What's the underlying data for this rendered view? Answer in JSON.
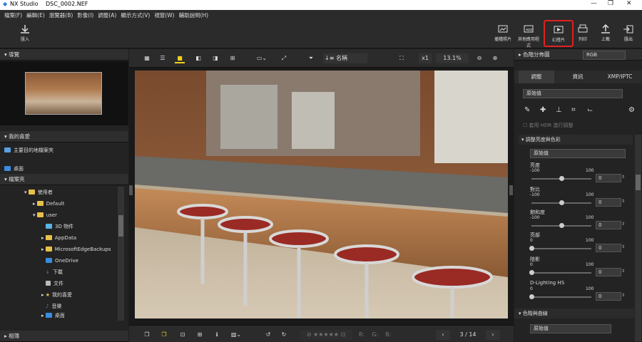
{
  "window": {
    "app": "NX Studio",
    "file": "DSC_0002.NEF"
  },
  "menu": [
    "檔案(F)",
    "編輯(E)",
    "瀏覽器(B)",
    "影像(I)",
    "調整(A)",
    "顯示方式(V)",
    "視窗(W)",
    "輔助說明(H)"
  ],
  "toolbar": {
    "import": "匯入",
    "batch": "播種照片",
    "other": "其他應用程式",
    "slideshow": "幻燈片",
    "print": "列印",
    "upload": "上載",
    "export": "匯出"
  },
  "left": {
    "navigator": "導覽",
    "favorites": "我的喜愛",
    "fav_item": "主要目的地檔案夾",
    "desktop": "桌面",
    "folders": "檔案夾",
    "tree": [
      "使用者",
      "Default",
      "user",
      "3D 物件",
      "AppData",
      "MicrosoftEdgeBackups",
      "OneDrive",
      "下載",
      "文件",
      "我的喜愛",
      "音樂",
      "桌面"
    ],
    "album": "相簿"
  },
  "viewer": {
    "sort": "名稱",
    "scale": "x1",
    "zoom": "13.1%",
    "page": "3 / 14",
    "rgb_labels": [
      "R:",
      "G:",
      "B:"
    ]
  },
  "right": {
    "histogram": "色階分佈圖",
    "channel": "RGB",
    "tabs": [
      "調整",
      "資訊",
      "XMP/IPTC"
    ],
    "preset": "原始值",
    "hdr": "套用 HDR 進行調整",
    "section1": "調整亮度與色彩",
    "preset2": "原始值",
    "sliders": [
      {
        "label": "亮度",
        "min": "-100",
        "max": "100",
        "value": "0",
        "pos": 0.5
      },
      {
        "label": "對比",
        "min": "-100",
        "max": "100",
        "value": "0",
        "pos": 0.5
      },
      {
        "label": "飽和度",
        "min": "-100",
        "max": "100",
        "value": "0",
        "pos": 0.5
      },
      {
        "label": "亮部",
        "min": "0",
        "max": "100",
        "value": "0",
        "pos": 0
      },
      {
        "label": "陰影",
        "min": "0",
        "max": "100",
        "value": "0",
        "pos": 0
      },
      {
        "label": "D-Lighting HS",
        "min": "0",
        "max": "100",
        "value": "0",
        "pos": 0
      }
    ],
    "section2": "色階與曲線",
    "preset3": "原始值"
  }
}
